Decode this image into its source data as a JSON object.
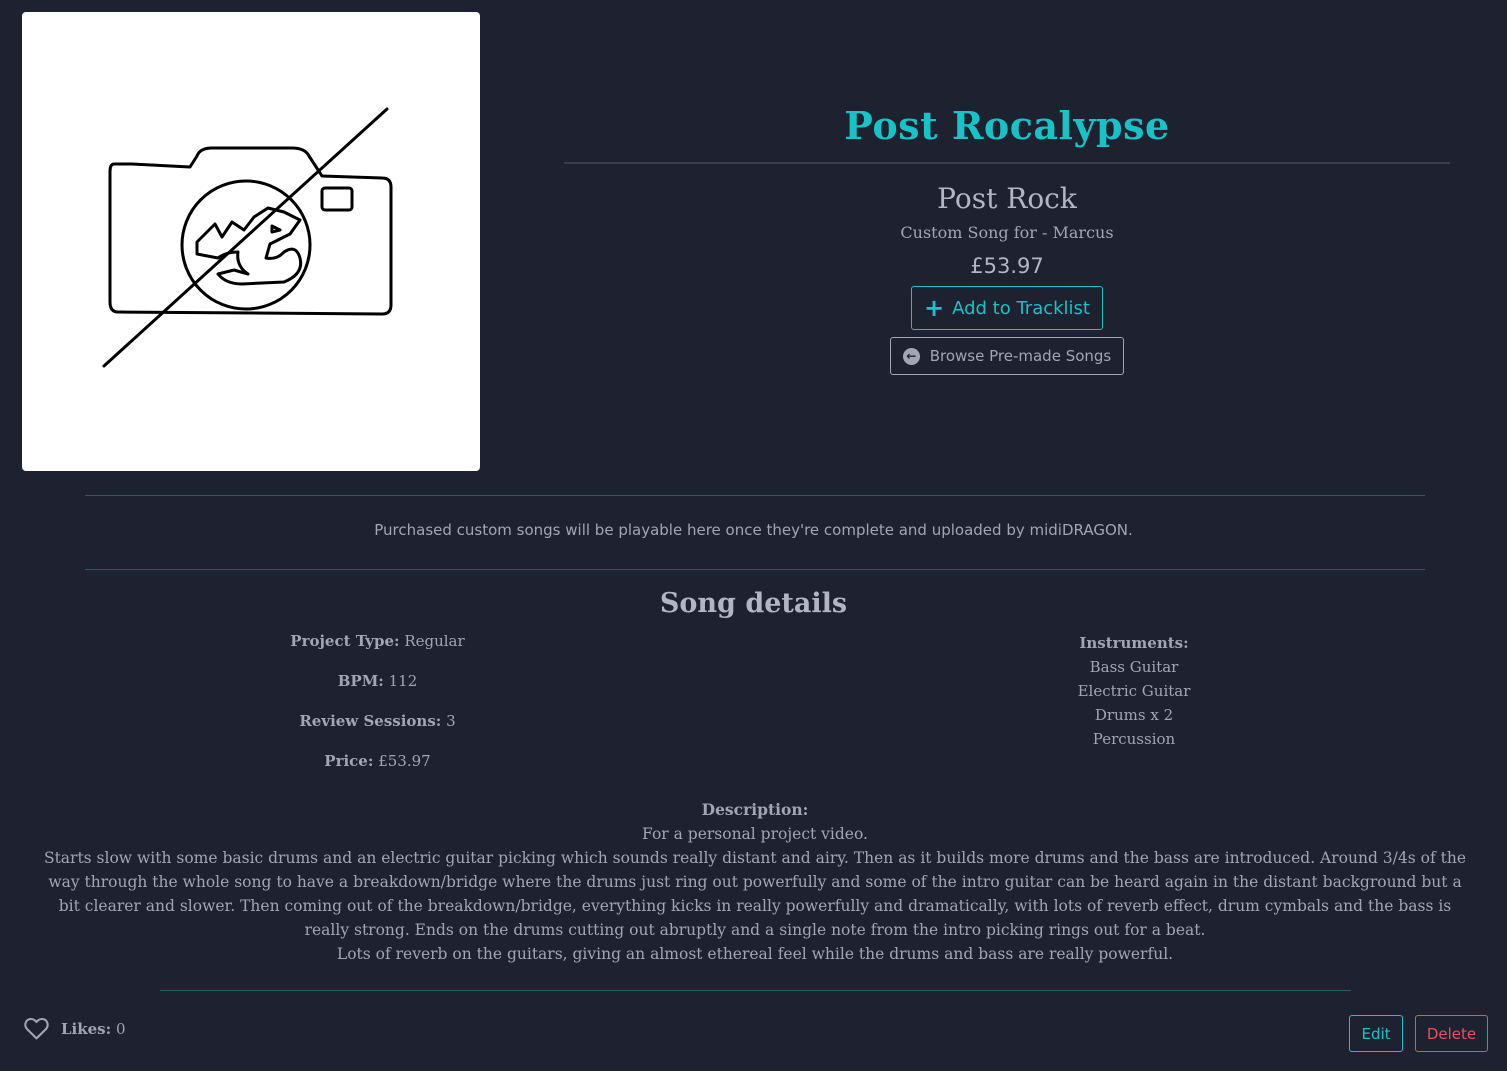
{
  "colors": {
    "background": "#1e212f",
    "accent": "#17c3c7",
    "danger": "#e2545c",
    "text": "#a3a5b3"
  },
  "cover": {
    "icon": "no-image-camera-icon"
  },
  "hero": {
    "title": "Post Rocalypse",
    "genre": "Post Rock",
    "customer": "Custom Song for - Marcus",
    "price": "£53.97",
    "add_button": "Add to Tracklist",
    "browse_button": "Browse Pre-made Songs"
  },
  "notice": "Purchased custom songs will be playable here once they're complete and uploaded by midiDRAGON.",
  "details": {
    "title": "Song details",
    "project_type_label": "Project Type:",
    "project_type": "Regular",
    "bpm_label": "BPM:",
    "bpm": "112",
    "review_label": "Review Sessions:",
    "review": "3",
    "price_label": "Price:",
    "price": "£53.97",
    "instruments_label": "Instruments:",
    "instruments": [
      "Bass Guitar",
      "Electric Guitar",
      "Drums x 2",
      "Percussion"
    ],
    "description_label": "Description:",
    "description": [
      "For a personal project video.",
      "Starts slow with some basic drums and an electric guitar picking which sounds really distant and airy. Then as it builds more drums and the bass are introduced. Around 3/4s of the way through the whole song to have a breakdown/bridge where the drums just ring out powerfully and some of the intro guitar can be heard again in the distant background but a bit clearer and slower. Then coming out of the breakdown/bridge, everything kicks in really powerfully and dramatically, with lots of reverb effect, drum cymbals and the bass is really strong. Ends on the drums cutting out abruptly and a single note from the intro picking rings out for a beat.",
      "Lots of reverb on the guitars, giving an almost ethereal feel while the drums and bass are really powerful."
    ]
  },
  "footer": {
    "likes_label": "Likes:",
    "likes_count": "0",
    "edit_button": "Edit",
    "delete_button": "Delete"
  }
}
